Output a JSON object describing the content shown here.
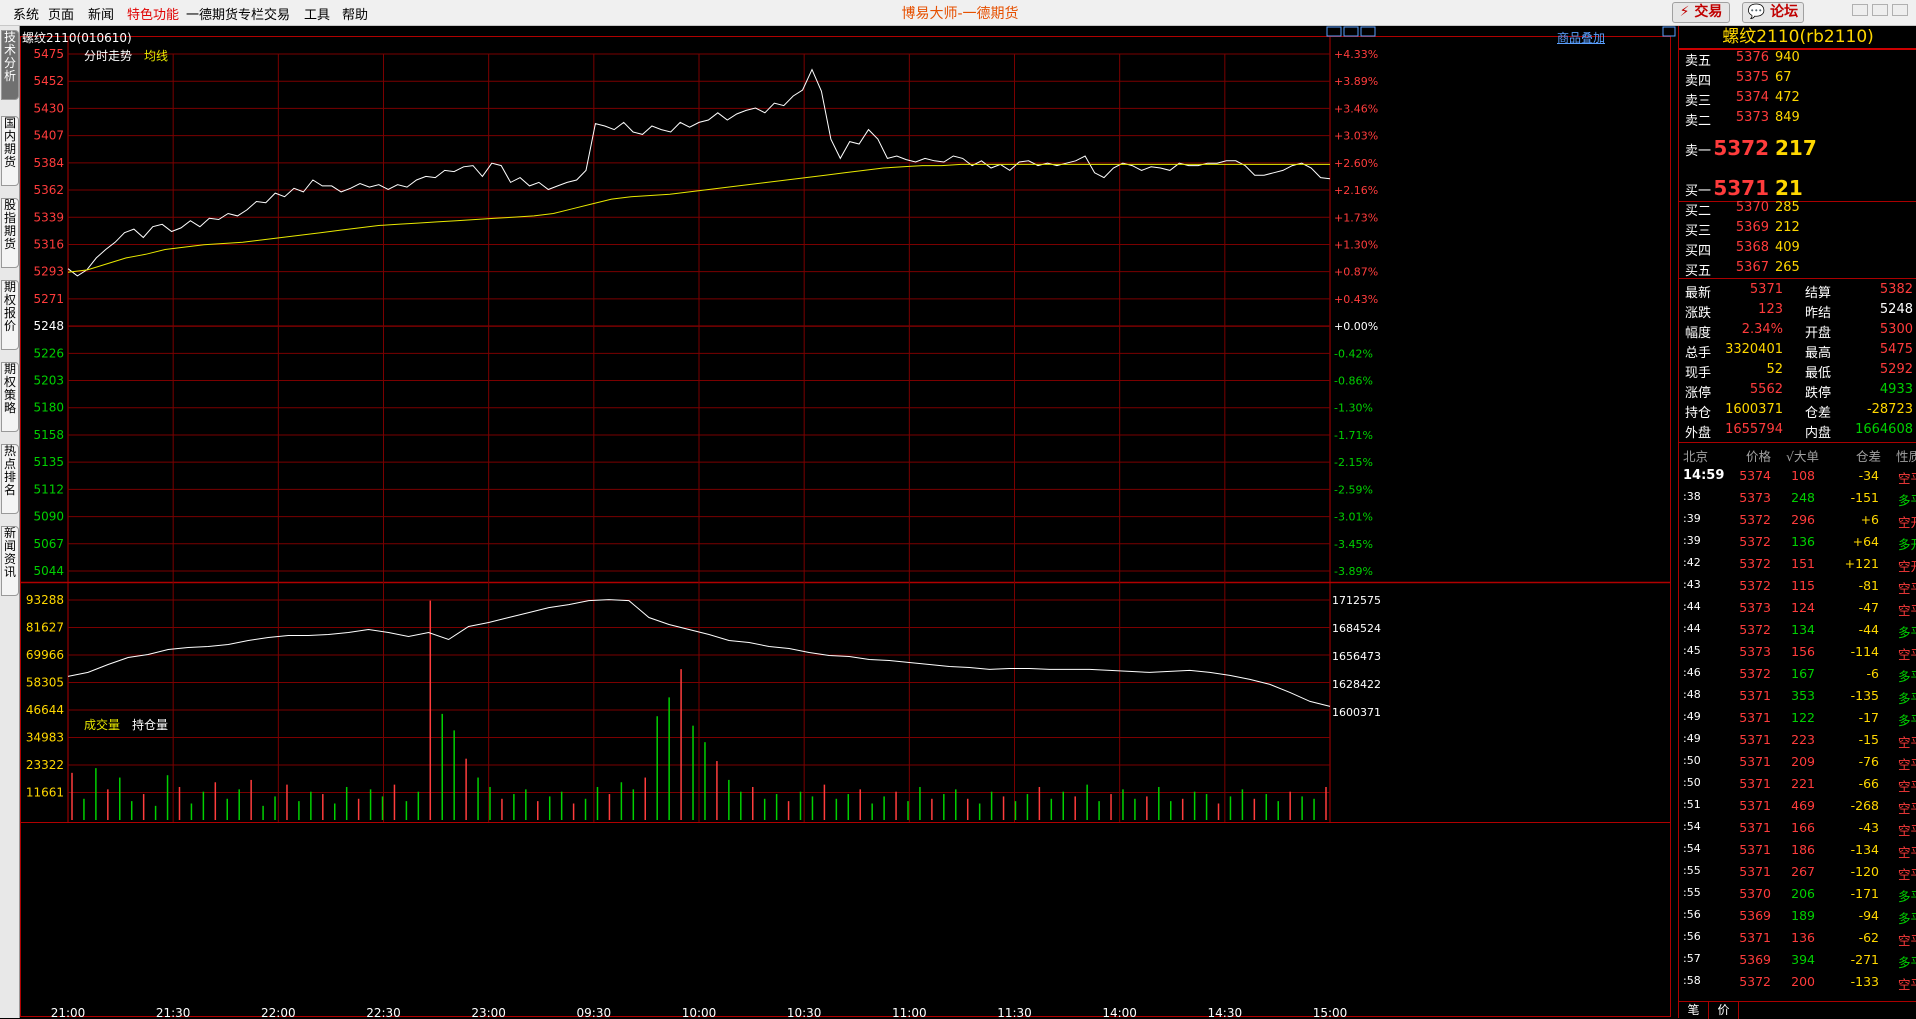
{
  "menu": [
    "系统",
    "页面",
    "新闻",
    "特色功能",
    "一德期货专栏",
    "交易",
    "工具",
    "帮助"
  ],
  "app_title": "博易大师-一德期货",
  "top_buttons": {
    "trade": "⚡ 交易",
    "forum": "💬 论坛"
  },
  "side_tabs": [
    {
      "label": "技术分析",
      "active": true
    },
    {
      "label": "国内期货",
      "active": false
    },
    {
      "label": "股指期货",
      "active": false
    },
    {
      "label": "期权报价",
      "active": false
    },
    {
      "label": "期权策略",
      "active": false
    },
    {
      "label": "热点排名",
      "active": false
    },
    {
      "label": "新闻资讯",
      "active": false
    }
  ],
  "chart_header": {
    "symbol": "螺纹2110(010610)",
    "overlay_link": "商品叠加"
  },
  "colors": {
    "up": "#ff3c3c",
    "down": "#00d000",
    "neutral": "#ffffff",
    "avg": "#e8e800",
    "grid": "#7a0000",
    "accent": "#ffd700"
  },
  "chart_data": [
    {
      "type": "line",
      "title": "分时走势",
      "legend": [
        "分时走势",
        "均线"
      ],
      "prev_settle": 5248,
      "y_ticks": [
        5475,
        5452,
        5430,
        5407,
        5384,
        5362,
        5339,
        5316,
        5293,
        5271,
        5248,
        5226,
        5203,
        5180,
        5158,
        5135,
        5112,
        5090,
        5067,
        5044
      ],
      "right_ticks": [
        "+4.33%",
        "+3.89%",
        "+3.46%",
        "+3.03%",
        "+2.60%",
        "+2.16%",
        "+1.73%",
        "+1.30%",
        "+0.87%",
        "+0.43%",
        "+0.00%",
        "-0.42%",
        "-0.86%",
        "-1.30%",
        "-1.71%",
        "-2.15%",
        "-2.59%",
        "-3.01%",
        "-3.45%",
        "-3.89%"
      ],
      "x_ticks": [
        "21:00",
        "21:30",
        "22:00",
        "22:30",
        "23:00",
        "09:30",
        "10:00",
        "10:30",
        "11:00",
        "11:30",
        "14:00",
        "14:30",
        "15:00"
      ],
      "price": [
        5296,
        5290,
        5295,
        5305,
        5312,
        5318,
        5326,
        5329,
        5322,
        5331,
        5333,
        5327,
        5330,
        5336,
        5331,
        5338,
        5337,
        5342,
        5340,
        5345,
        5352,
        5351,
        5359,
        5356,
        5363,
        5360,
        5370,
        5365,
        5365,
        5360,
        5363,
        5367,
        5364,
        5366,
        5362,
        5366,
        5364,
        5370,
        5373,
        5372,
        5378,
        5377,
        5381,
        5382,
        5373,
        5384,
        5382,
        5368,
        5372,
        5365,
        5368,
        5362,
        5365,
        5368,
        5370,
        5378,
        5417,
        5415,
        5412,
        5418,
        5410,
        5408,
        5415,
        5412,
        5410,
        5418,
        5414,
        5418,
        5420,
        5426,
        5420,
        5425,
        5428,
        5430,
        5426,
        5434,
        5432,
        5440,
        5445,
        5462,
        5444,
        5404,
        5388,
        5402,
        5400,
        5412,
        5404,
        5388,
        5390,
        5387,
        5385,
        5388,
        5386,
        5385,
        5390,
        5388,
        5382,
        5386,
        5380,
        5383,
        5378,
        5385,
        5386,
        5382,
        5384,
        5382,
        5384,
        5386,
        5390,
        5376,
        5372,
        5380,
        5384,
        5382,
        5378,
        5381,
        5380,
        5378,
        5384,
        5382,
        5382,
        5384,
        5384,
        5386,
        5386,
        5382,
        5374,
        5374,
        5376,
        5378,
        5382,
        5384,
        5380,
        5372,
        5371
      ],
      "avg": [
        5293,
        5295,
        5300,
        5305,
        5308,
        5312,
        5314,
        5316,
        5317,
        5318,
        5320,
        5322,
        5324,
        5326,
        5328,
        5330,
        5332,
        5333,
        5334,
        5335,
        5336,
        5337,
        5338,
        5339,
        5340,
        5342,
        5346,
        5350,
        5354,
        5356,
        5357,
        5358,
        5360,
        5362,
        5364,
        5366,
        5368,
        5370,
        5372,
        5374,
        5376,
        5378,
        5380,
        5381,
        5382,
        5382,
        5383,
        5383,
        5383,
        5383,
        5383,
        5383,
        5383,
        5383,
        5383,
        5383,
        5383,
        5383,
        5383,
        5383,
        5383,
        5383,
        5383,
        5383,
        5383,
        5383
      ]
    },
    {
      "type": "bar",
      "title": "成交量",
      "legend": [
        "成交量",
        "持仓量"
      ],
      "y_ticks": [
        93288,
        81627,
        69966,
        58305,
        46644,
        34983,
        23322,
        11661
      ],
      "right_ticks": [
        1712575,
        1684524,
        1656473,
        1628422,
        1600371
      ],
      "oi": [
        1636000,
        1640000,
        1648000,
        1655000,
        1658000,
        1663000,
        1665000,
        1666000,
        1668000,
        1672000,
        1675000,
        1677000,
        1677000,
        1678000,
        1680000,
        1683000,
        1680000,
        1676000,
        1680000,
        1673000,
        1686000,
        1690000,
        1695000,
        1700000,
        1705000,
        1708000,
        1712000,
        1713000,
        1712000,
        1695000,
        1688000,
        1683000,
        1678000,
        1672000,
        1670000,
        1666000,
        1664000,
        1660000,
        1657000,
        1656000,
        1653000,
        1652000,
        1650000,
        1648000,
        1646000,
        1645000,
        1643000,
        1644000,
        1644000,
        1643000,
        1643000,
        1643000,
        1642000,
        1641000,
        1640000,
        1641000,
        1642000,
        1640000,
        1637000,
        1633000,
        1628000,
        1620000,
        1611000,
        1606000
      ],
      "volume": [
        20000,
        9000,
        22000,
        13000,
        18000,
        8000,
        11000,
        6000,
        19000,
        14000,
        7000,
        12000,
        16000,
        9000,
        13000,
        17000,
        6000,
        10000,
        15000,
        8000,
        12000,
        11000,
        7000,
        14000,
        9000,
        13000,
        10000,
        15000,
        8000,
        12000,
        93000,
        45000,
        38000,
        26000,
        18000,
        14000,
        9000,
        11000,
        13000,
        8000,
        10000,
        12000,
        7000,
        9000,
        14000,
        11000,
        16000,
        13000,
        18000,
        44000,
        52000,
        64000,
        40000,
        33000,
        25000,
        17000,
        12000,
        14000,
        9000,
        11000,
        8000,
        12000,
        10000,
        15000,
        9000,
        11000,
        13000,
        7000,
        10000,
        12000,
        8000,
        14000,
        9000,
        11000,
        13000,
        9000,
        7000,
        12000,
        10000,
        8000,
        11000,
        14000,
        9000,
        12000,
        10000,
        15000,
        8000,
        11000,
        13000,
        9000,
        10000,
        14000,
        8000,
        9000,
        12000,
        11000,
        7000,
        10000,
        13000,
        9000,
        11000,
        8000,
        12000,
        10000,
        9000,
        14000
      ]
    }
  ],
  "quote": {
    "title": "螺纹2110(rb2110)",
    "asks": [
      {
        "label": "卖五",
        "price": "5376",
        "vol": "940"
      },
      {
        "label": "卖四",
        "price": "5375",
        "vol": "67"
      },
      {
        "label": "卖三",
        "price": "5374",
        "vol": "472"
      },
      {
        "label": "卖二",
        "price": "5373",
        "vol": "849"
      },
      {
        "label": "卖一",
        "price": "5372",
        "vol": "217"
      }
    ],
    "bids": [
      {
        "label": "买一",
        "price": "5371",
        "vol": "21"
      },
      {
        "label": "买二",
        "price": "5370",
        "vol": "285"
      },
      {
        "label": "买三",
        "price": "5369",
        "vol": "212"
      },
      {
        "label": "买四",
        "price": "5368",
        "vol": "409"
      },
      {
        "label": "买五",
        "price": "5367",
        "vol": "265"
      }
    ],
    "stats": [
      {
        "l1": "最新",
        "v1": "5371",
        "c1": "#ff3c3c",
        "l2": "结算",
        "v2": "5382",
        "c2": "#ff3c3c"
      },
      {
        "l1": "涨跌",
        "v1": "123",
        "c1": "#ff3c3c",
        "l2": "昨结",
        "v2": "5248",
        "c2": "#ffffff"
      },
      {
        "l1": "幅度",
        "v1": "2.34%",
        "c1": "#ff3c3c",
        "l2": "开盘",
        "v2": "5300",
        "c2": "#ff3c3c"
      },
      {
        "l1": "总手",
        "v1": "3320401",
        "c1": "#ffd700",
        "l2": "最高",
        "v2": "5475",
        "c2": "#ff3c3c"
      },
      {
        "l1": "现手",
        "v1": "52",
        "c1": "#ffd700",
        "l2": "最低",
        "v2": "5292",
        "c2": "#ff3c3c"
      },
      {
        "l1": "涨停",
        "v1": "5562",
        "c1": "#ff3c3c",
        "l2": "跌停",
        "v2": "4933",
        "c2": "#00d000"
      },
      {
        "l1": "持仓",
        "v1": "1600371",
        "c1": "#ffd700",
        "l2": "仓差",
        "v2": "-28723",
        "c2": "#ffd700"
      },
      {
        "l1": "外盘",
        "v1": "1655794",
        "c1": "#ff3c3c",
        "l2": "内盘",
        "v2": "1664608",
        "c2": "#00d000"
      }
    ],
    "trade_header": [
      "北京",
      "价格",
      "√大单",
      "仓差",
      "性质"
    ],
    "trades": [
      {
        "t": "14:59",
        "p": "5374",
        "v": "108",
        "d": "-34",
        "n": "空平"
      },
      {
        "t": ":38",
        "p": "5373",
        "v": "248",
        "d": "-151",
        "n": "多平"
      },
      {
        "t": ":39",
        "p": "5372",
        "v": "296",
        "d": "+6",
        "n": "空开"
      },
      {
        "t": ":39",
        "p": "5372",
        "v": "136",
        "d": "+64",
        "n": "多开"
      },
      {
        "t": ":42",
        "p": "5372",
        "v": "151",
        "d": "+121",
        "n": "空开"
      },
      {
        "t": ":43",
        "p": "5372",
        "v": "115",
        "d": "-81",
        "n": "空平"
      },
      {
        "t": ":44",
        "p": "5373",
        "v": "124",
        "d": "-47",
        "n": "空平"
      },
      {
        "t": ":44",
        "p": "5372",
        "v": "134",
        "d": "-44",
        "n": "多平"
      },
      {
        "t": ":45",
        "p": "5373",
        "v": "156",
        "d": "-114",
        "n": "空平"
      },
      {
        "t": ":46",
        "p": "5372",
        "v": "167",
        "d": "-6",
        "n": "多平"
      },
      {
        "t": ":48",
        "p": "5371",
        "v": "353",
        "d": "-135",
        "n": "多平"
      },
      {
        "t": ":49",
        "p": "5371",
        "v": "122",
        "d": "-17",
        "n": "多平"
      },
      {
        "t": ":49",
        "p": "5371",
        "v": "223",
        "d": "-15",
        "n": "空平"
      },
      {
        "t": ":50",
        "p": "5371",
        "v": "209",
        "d": "-76",
        "n": "空平"
      },
      {
        "t": ":50",
        "p": "5371",
        "v": "221",
        "d": "-66",
        "n": "空平"
      },
      {
        "t": ":51",
        "p": "5371",
        "v": "469",
        "d": "-268",
        "n": "空平"
      },
      {
        "t": ":54",
        "p": "5371",
        "v": "166",
        "d": "-43",
        "n": "空平"
      },
      {
        "t": ":54",
        "p": "5371",
        "v": "186",
        "d": "-134",
        "n": "空平"
      },
      {
        "t": ":55",
        "p": "5371",
        "v": "267",
        "d": "-120",
        "n": "空平"
      },
      {
        "t": ":55",
        "p": "5370",
        "v": "206",
        "d": "-171",
        "n": "多平"
      },
      {
        "t": ":56",
        "p": "5369",
        "v": "189",
        "d": "-94",
        "n": "多平"
      },
      {
        "t": ":56",
        "p": "5371",
        "v": "136",
        "d": "-62",
        "n": "空平"
      },
      {
        "t": ":57",
        "p": "5369",
        "v": "394",
        "d": "-271",
        "n": "多平"
      },
      {
        "t": ":58",
        "p": "5372",
        "v": "200",
        "d": "-133",
        "n": "空平"
      }
    ],
    "bottom_tabs": [
      "笔",
      "价"
    ]
  }
}
